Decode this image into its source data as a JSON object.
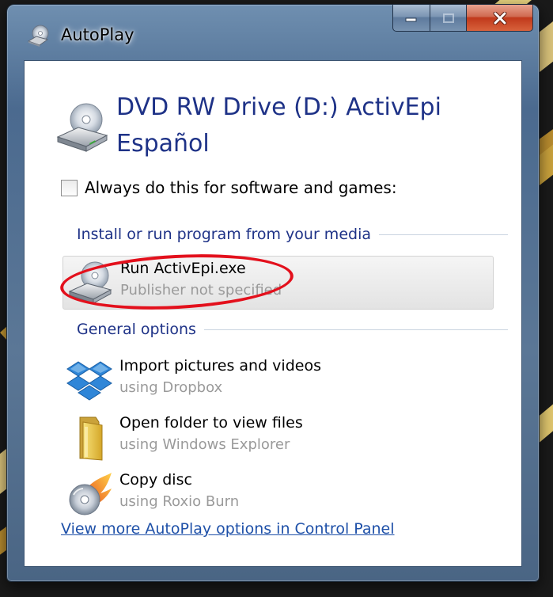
{
  "window": {
    "title": "AutoPlay",
    "minimize_icon": "minimize-icon",
    "maximize_icon": "maximize-icon",
    "close_icon": "close-icon"
  },
  "device": {
    "title": "DVD RW Drive (D:) ActivEpi Español",
    "icon": "dvd-drive-icon"
  },
  "always_checkbox": {
    "label": "Always do this for software and games:",
    "checked": false
  },
  "sections": {
    "install": "Install or run program from your media",
    "general": "General options"
  },
  "options": [
    {
      "title": "Run ActivEpi.exe",
      "subtitle": "Publisher not specified",
      "icon": "dvd-drive-icon",
      "selected": true
    },
    {
      "title": "Import pictures and videos",
      "subtitle": "using Dropbox",
      "icon": "dropbox-icon",
      "selected": false
    },
    {
      "title": "Open folder to view files",
      "subtitle": "using Windows Explorer",
      "icon": "folder-icon",
      "selected": false
    },
    {
      "title": "Copy disc",
      "subtitle": "using Roxio Burn",
      "icon": "roxio-burn-icon",
      "selected": false
    }
  ],
  "control_panel_link": "View more AutoPlay options in Control Panel",
  "colors": {
    "heading_blue": "#1e3287",
    "link_blue": "#1e50a8",
    "annotation_red": "#e3101c",
    "close_button_red": "#c0391b"
  }
}
